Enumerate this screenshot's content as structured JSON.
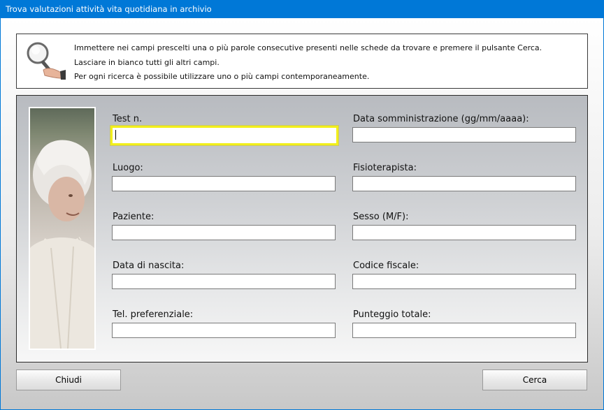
{
  "window": {
    "title": "Trova valutazioni attività vita quotidiana in archivio"
  },
  "info": {
    "lines": [
      "Immettere nei campi prescelti una o più parole consecutive presenti nelle schede da trovare e premere il pulsante Cerca.",
      "Lasciare in bianco tutti gli altri campi.",
      "Per ogni ricerca è possibile utilizzare uno o più campi contemporaneamente."
    ],
    "icon": "magnifier-hand-icon"
  },
  "form": {
    "left_fields": [
      {
        "label": "Test n.",
        "value": ""
      },
      {
        "label": "Luogo:",
        "value": ""
      },
      {
        "label": "Paziente:",
        "value": ""
      },
      {
        "label": "Data di nascita:",
        "value": ""
      },
      {
        "label": "Tel. preferenziale:",
        "value": ""
      }
    ],
    "right_fields": [
      {
        "label": "Data somministrazione (gg/mm/aaaa):",
        "value": ""
      },
      {
        "label": "Fisioterapista:",
        "value": ""
      },
      {
        "label": "Sesso (M/F):",
        "value": ""
      },
      {
        "label": "Codice fiscale:",
        "value": ""
      },
      {
        "label": "Punteggio totale:",
        "value": ""
      }
    ],
    "focus_color": "#f2ef1a"
  },
  "buttons": {
    "close_label": "Chiudi",
    "search_label": "Cerca"
  },
  "colors": {
    "titlebar": "#0078d7"
  }
}
